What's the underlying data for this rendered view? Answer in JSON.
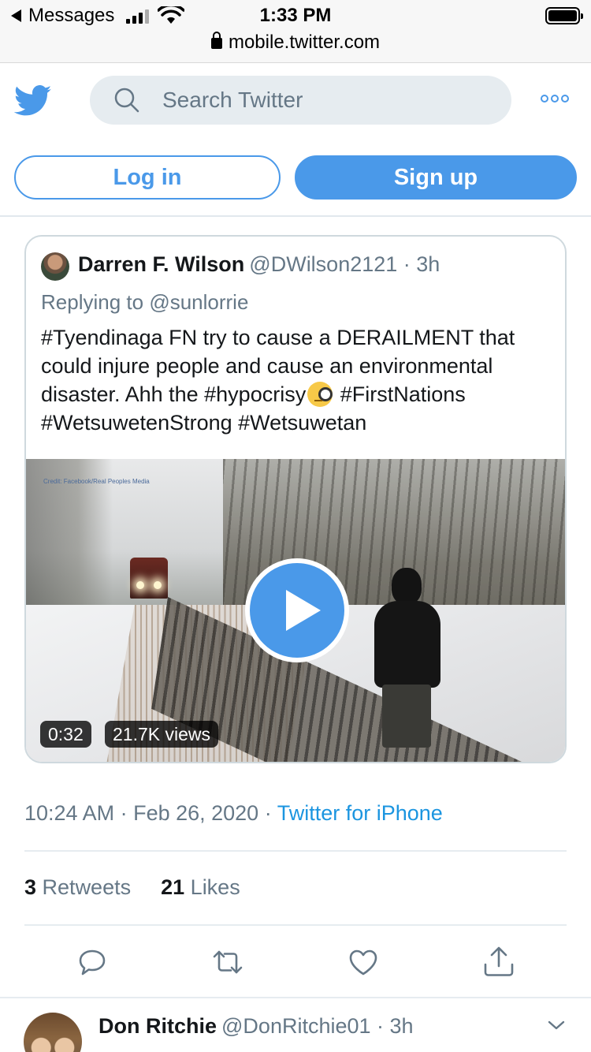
{
  "status_bar": {
    "back_app": "Messages",
    "time": "1:33 PM",
    "url": "mobile.twitter.com"
  },
  "header": {
    "search_placeholder": "Search Twitter",
    "login_label": "Log in",
    "signup_label": "Sign up",
    "accent_color": "#4a99e9"
  },
  "tweet": {
    "author_name": "Darren F. Wilson",
    "author_handle": "@DWilson2121 · 3h",
    "replying_prefix": "Replying to ",
    "replying_to": "@sunlorrie",
    "text_before_emoji": "#Tyendinaga FN try to cause a DERAILMENT that could injure people and cause an environmental disaster. Ahh the #hypocrisy",
    "emoji": "face-with-monocle",
    "text_after_emoji": " #FirstNations #WetsuwetenStrong #Wetsuwetan",
    "video": {
      "credit": "Credit: Facebook/Real Peoples Media",
      "duration": "0:32",
      "views": "21.7K views"
    },
    "timestamp": "10:24 AM · Feb 26, 2020 · ",
    "source": "Twitter for iPhone",
    "retweets_count": "3",
    "retweets_label": "Retweets",
    "likes_count": "21",
    "likes_label": "Likes",
    "actions": [
      "reply-icon",
      "retweet-icon",
      "like-icon",
      "share-icon"
    ]
  },
  "next_reply": {
    "author_name": "Don Ritchie",
    "author_handle": "@DonRitchie01 · 3h"
  }
}
